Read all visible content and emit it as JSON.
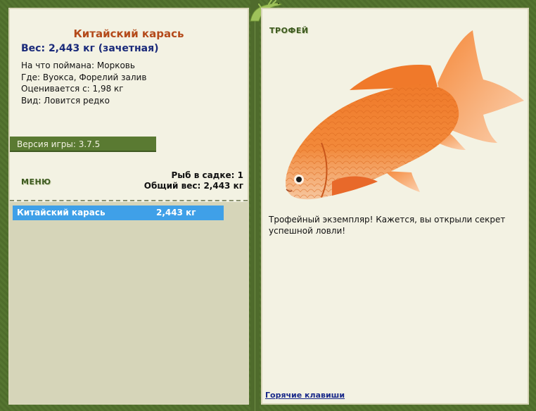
{
  "left": {
    "fish_name": "Китайский карась",
    "weight": "Вес: 2,443 кг (зачетная)",
    "info": [
      "На что поймана: Морковь",
      "Где: Вуокса, Форелий залив",
      "Оценивается с: 1,98 кг",
      "Вид: Ловится редко"
    ],
    "version": "Версия игры: 3.7.5",
    "menu_label": "МЕНЮ",
    "stats": {
      "count": "Рыб в садке: 1",
      "total": "Общий вес: 2,443 кг"
    },
    "catch_list": [
      {
        "name": "Китайский карась",
        "weight": "2,443 кг"
      }
    ]
  },
  "right": {
    "trophy_label": "ТРОФЕЙ",
    "trophy_text": "Трофейный экземпляр! Кажется, вы открыли секрет успешной ловли!",
    "hotkeys_link": "Горячие клавиши"
  },
  "colors": {
    "frame_green": "#5a7a32",
    "panel_bg": "#f3f2e3",
    "fish_title": "#b44a1a",
    "weight_text": "#1a2a7a",
    "selected_row": "#3fa0e8",
    "link": "#1a2a8a"
  },
  "icons": {
    "decoration": "lizard-icon",
    "trophy_image": "goldfish-icon"
  }
}
